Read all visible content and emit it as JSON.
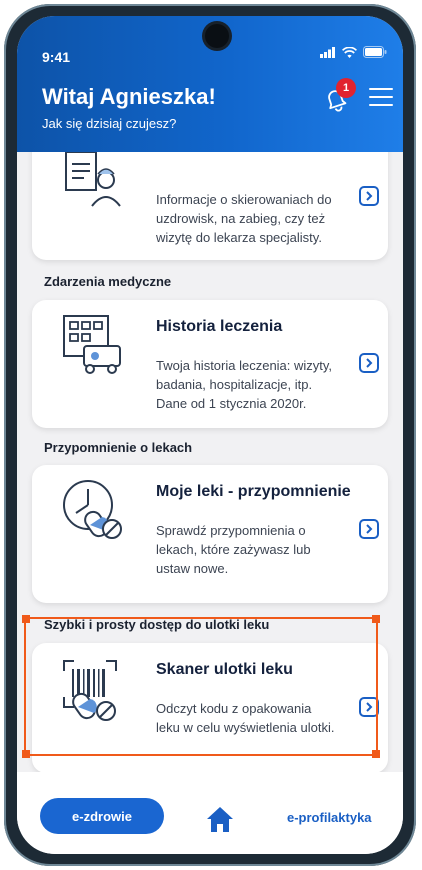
{
  "status_bar": {
    "time": "9:41"
  },
  "header": {
    "title": "Witaj Agnieszka!",
    "subtitle": "Jak się dzisiaj czujesz?",
    "notification_count": "1"
  },
  "cards": [
    {
      "title": "",
      "description": "Informacje o skierowaniach do uzdrowisk, na zabieg, czy też wizytę do lekarza specjalisty."
    },
    {
      "section": "Zdarzenia medyczne",
      "title": "Historia leczenia",
      "description": "Twoja historia leczenia: wizyty, badania, hospitalizacje, itp. Dane od 1 stycznia 2020r."
    },
    {
      "section": "Przypomnienie o lekach",
      "title": "Moje leki - przypomnienie",
      "description": "Sprawdź przypomnienia o lekach, które zażywasz lub ustaw nowe."
    },
    {
      "section": "Szybki i prosty dostęp do ulotki leku",
      "title": "Skaner ulotki leku",
      "description": "Odczyt kodu z opakowania leku w celu wyświetlenia ulotki."
    }
  ],
  "nav": {
    "primary_label": "e-zdrowie",
    "secondary_label": "e-profilaktyka"
  },
  "colors": {
    "brand_blue": "#1166cc",
    "highlight_orange": "#f05a1a",
    "badge_red": "#e1232f"
  },
  "icons": [
    "bell-icon",
    "menu-icon",
    "chevron-right-icon",
    "home-icon",
    "signal-icon",
    "wifi-icon",
    "battery-icon"
  ]
}
